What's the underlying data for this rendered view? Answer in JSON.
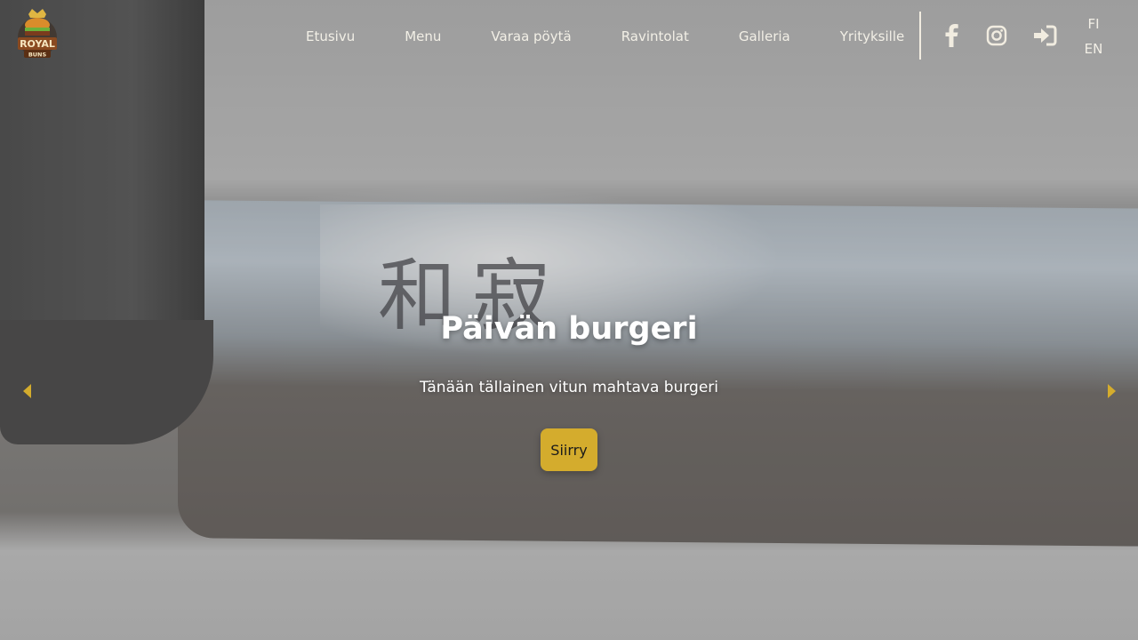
{
  "brand": {
    "logo_top": "ROYAL",
    "logo_bottom": "BUNS"
  },
  "nav": {
    "items": [
      {
        "label": "Etusivu"
      },
      {
        "label": "Menu"
      },
      {
        "label": "Varaa pöytä"
      },
      {
        "label": "Ravintolat"
      },
      {
        "label": "Galleria"
      },
      {
        "label": "Yrityksille"
      }
    ],
    "icons": [
      "facebook-icon",
      "instagram-icon",
      "login-icon"
    ],
    "languages": [
      "FI",
      "EN"
    ]
  },
  "hero": {
    "title": "Päivän burgeri",
    "subtitle": "Tänään tällainen vitun mahtava burgeri",
    "cta_label": "Siirry",
    "background_text": "和寂"
  },
  "colors": {
    "accent": "#d4ac2d",
    "nav_text": "#f2efe6",
    "hero_text": "#ffffff"
  }
}
